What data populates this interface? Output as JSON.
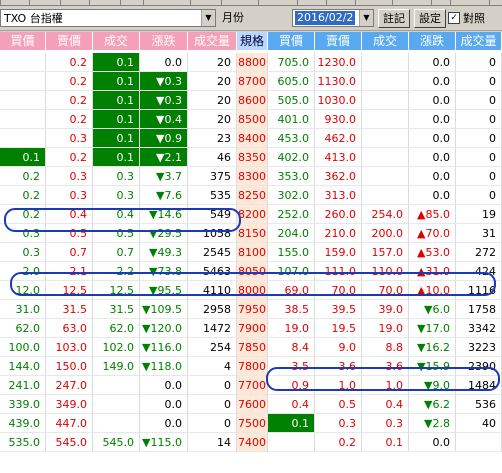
{
  "toolbar": {
    "product": "TXO 台指權",
    "period": "月份",
    "date": "2016/02/2",
    "note_button": "註記",
    "settings_button": "設定",
    "align_checkbox_checked": true,
    "align_label": "對照"
  },
  "columns": [
    "買價",
    "賣價",
    "成交",
    "漲跌",
    "成交量",
    "規格",
    "買價",
    "賣價",
    "成交",
    "漲跌",
    "成交量"
  ],
  "rows": [
    [
      "",
      "0.2",
      "0.1",
      "0.0",
      "20",
      "8800",
      "705.0",
      "1230.0",
      "",
      "0.0",
      "0"
    ],
    [
      "",
      "0.2",
      "0.1",
      "▼0.3",
      "20",
      "8700",
      "605.0",
      "1130.0",
      "",
      "0.0",
      "0"
    ],
    [
      "",
      "0.2",
      "0.1",
      "▼0.3",
      "20",
      "8600",
      "505.0",
      "1030.0",
      "",
      "0.0",
      "0"
    ],
    [
      "",
      "0.2",
      "0.1",
      "▼0.4",
      "20",
      "8500",
      "401.0",
      "930.0",
      "",
      "0.0",
      "0"
    ],
    [
      "",
      "0.3",
      "0.1",
      "▼0.9",
      "23",
      "8400",
      "453.0",
      "462.0",
      "",
      "0.0",
      "0"
    ],
    [
      "0.1",
      "0.2",
      "0.1",
      "▼2.1",
      "46",
      "8350",
      "402.0",
      "413.0",
      "",
      "0.0",
      "0"
    ],
    [
      "0.2",
      "0.3",
      "0.3",
      "▼3.7",
      "375",
      "8300",
      "353.0",
      "362.0",
      "",
      "0.0",
      "0"
    ],
    [
      "0.2",
      "0.3",
      "0.3",
      "▼7.6",
      "535",
      "8250",
      "302.0",
      "313.0",
      "",
      "0.0",
      "0"
    ],
    [
      "0.2",
      "0.4",
      "0.4",
      "▼14.6",
      "549",
      "8200",
      "252.0",
      "260.0",
      "254.0",
      "▲85.0",
      "19"
    ],
    [
      "0.3",
      "0.5",
      "0.5",
      "▼29.5",
      "1058",
      "8150",
      "204.0",
      "210.0",
      "200.0",
      "▲70.0",
      "31"
    ],
    [
      "0.3",
      "0.7",
      "0.7",
      "▼49.3",
      "2545",
      "8100",
      "155.0",
      "159.0",
      "157.0",
      "▲53.0",
      "272"
    ],
    [
      "2.0",
      "2.1",
      "2.2",
      "▼73.8",
      "5463",
      "8050",
      "107.0",
      "111.0",
      "110.0",
      "▲31.0",
      "424"
    ],
    [
      "12.0",
      "12.5",
      "12.5",
      "▼95.5",
      "4110",
      "8000",
      "69.0",
      "70.0",
      "70.0",
      "▲10.0",
      "1116"
    ],
    [
      "31.0",
      "31.5",
      "31.5",
      "▼109.5",
      "2958",
      "7950",
      "38.5",
      "39.5",
      "39.0",
      "▼6.0",
      "1758"
    ],
    [
      "62.0",
      "63.0",
      "62.0",
      "▼120.0",
      "1472",
      "7900",
      "19.0",
      "19.5",
      "19.0",
      "▼17.0",
      "3342"
    ],
    [
      "100.0",
      "103.0",
      "102.0",
      "▼116.0",
      "254",
      "7850",
      "8.4",
      "9.0",
      "8.8",
      "▼16.2",
      "3223"
    ],
    [
      "144.0",
      "150.0",
      "149.0",
      "▼118.0",
      "4",
      "7800",
      "3.5",
      "3.6",
      "3.6",
      "▼15.9",
      "2390"
    ],
    [
      "241.0",
      "247.0",
      "",
      "0.0",
      "0",
      "7700",
      "0.9",
      "1.0",
      "1.0",
      "▼9.0",
      "1484"
    ],
    [
      "339.0",
      "349.0",
      "",
      "0.0",
      "0",
      "7600",
      "0.4",
      "0.5",
      "0.4",
      "▼6.2",
      "536"
    ],
    [
      "439.0",
      "447.0",
      "",
      "0.0",
      "0",
      "7500",
      "0.1",
      "0.3",
      "0.3",
      "▼2.8",
      "40"
    ],
    [
      "535.0",
      "545.0",
      "545.0",
      "▼115.0",
      "14",
      "7400",
      "",
      "0.2",
      "0.1",
      "0.0",
      ""
    ]
  ],
  "colors": {
    "call_header": "#f4a0b8",
    "put_header": "#59a9f0",
    "strike_bg": "#ffe8d8",
    "up": "#e00000",
    "down": "#008000",
    "highlight": "#008000",
    "oval": "#1a3ab8"
  }
}
